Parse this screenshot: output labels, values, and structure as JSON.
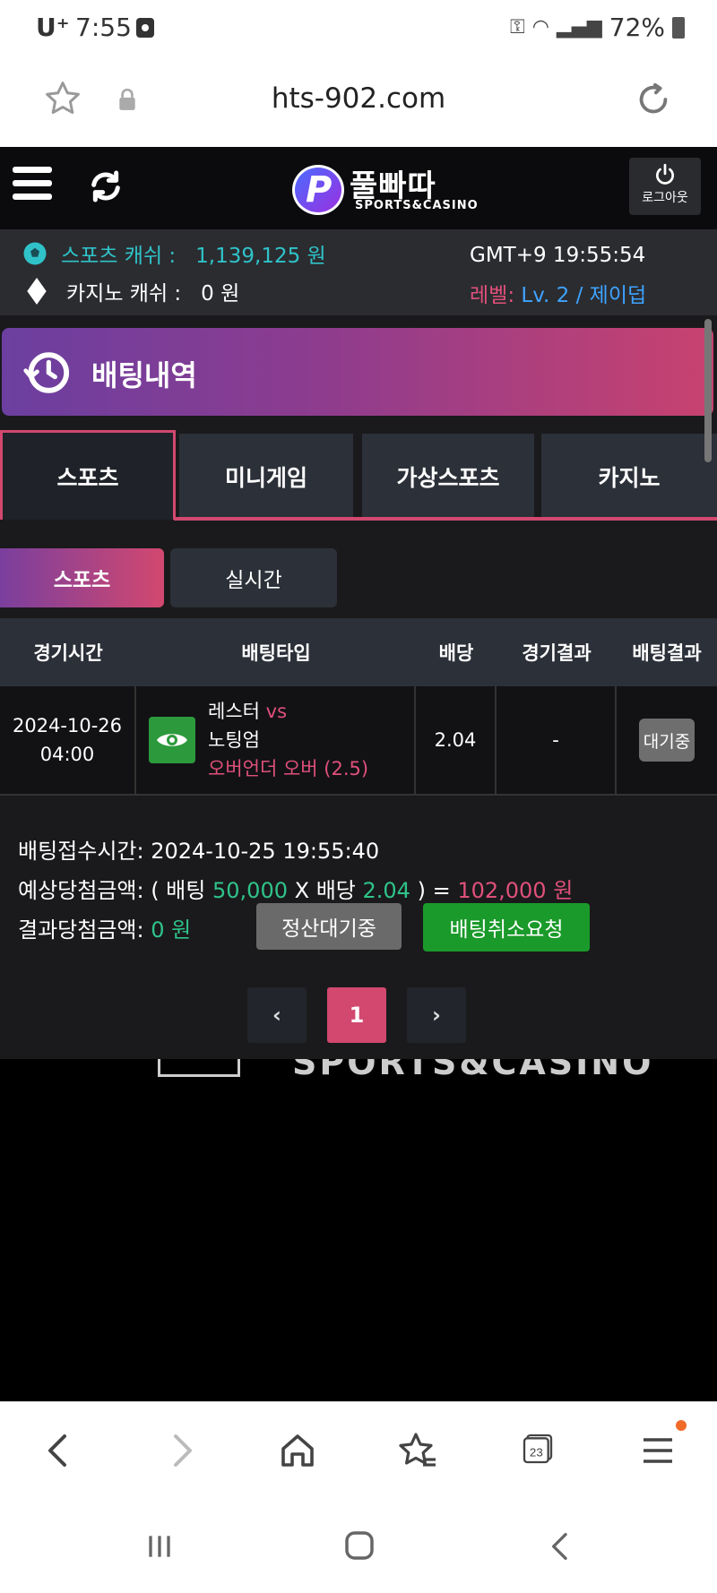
{
  "status_bar": {
    "carrier": "U⁺",
    "time": "7:55",
    "battery": "72%"
  },
  "browser": {
    "url": "hts-902.com"
  },
  "site": {
    "logo_text": "풀빠따",
    "logo_sub": "SPORTS&CASINO",
    "logout_label": "로그아웃"
  },
  "info": {
    "sports_cash_label": "스포츠 캐쉬 :",
    "sports_cash_value": "1,139,125 원",
    "casino_cash_label": "카지노 캐쉬 :",
    "casino_cash_value": "0 원",
    "gmt": "GMT+9 19:55:54",
    "level_label": "레벨:",
    "level_value": "Lv. 2 / 제이덥"
  },
  "page": {
    "title": "배팅내역"
  },
  "tabs": [
    {
      "label": "스포츠"
    },
    {
      "label": "미니게임"
    },
    {
      "label": "가상스포츠"
    },
    {
      "label": "카지노"
    }
  ],
  "subtabs": [
    {
      "label": "스포츠"
    },
    {
      "label": "실시간"
    }
  ],
  "table": {
    "headers": [
      "경기시간",
      "배팅타입",
      "배당",
      "경기결과",
      "배팅결과"
    ],
    "rows": [
      {
        "date": "2024-10-26",
        "time": "04:00",
        "home": "레스터",
        "vs": "vs",
        "away": "노팅엄",
        "market": "오버언더 오버 (2.5)",
        "odds": "2.04",
        "result": "-",
        "bet_result": "대기중"
      }
    ]
  },
  "summary": {
    "received_label": "배팅접수시간:",
    "received_value": "2024-10-25 19:55:40",
    "expected_label": "예상당첨금액: ( 배팅",
    "bet_amount": "50,000",
    "x_label": "X 배당",
    "odds": "2.04",
    "eq_label": ") =",
    "expected_win": "102,000 원",
    "result_label": "결과당첨금액:",
    "result_value": "0 원",
    "settle_button": "정산대기중",
    "cancel_button": "배팅취소요청"
  },
  "pagination": {
    "prev": "‹",
    "current": "1",
    "next": "›"
  },
  "bottom_nav": {
    "tabs_count": "23"
  },
  "colors": {
    "accent": "#d2486f",
    "cyan": "#2fc3c9",
    "green": "#2fc38a",
    "level_blue": "#3ea3ff"
  }
}
